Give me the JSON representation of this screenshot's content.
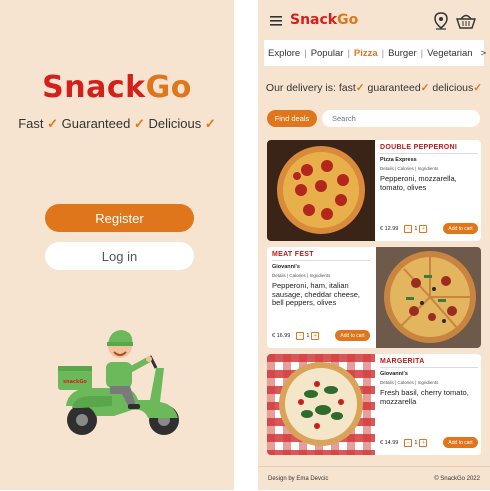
{
  "left": {
    "logo": {
      "part1": "Snack",
      "part2": "Go"
    },
    "tagline": {
      "w1": "Fast",
      "w2": "Guaranteed",
      "w3": "Delicious",
      "check": "✓"
    },
    "register_label": "Register",
    "login_label": "Log in"
  },
  "header": {
    "brand": {
      "part1": "Snack",
      "part2": "Go"
    },
    "icons": [
      "menu-icon",
      "location-pin-icon",
      "basket-icon"
    ]
  },
  "categories": [
    "Explore",
    "Popular",
    "Pizza",
    "Burger",
    "Vegetarian",
    ">"
  ],
  "active_category": "Pizza",
  "delivery": {
    "prefix": "Our delivery is:",
    "w1": "fast",
    "w2": "guaranteed",
    "w3": "delicious",
    "check": "✓"
  },
  "search": {
    "button_label": "Find deals",
    "placeholder": "Search"
  },
  "products": [
    {
      "title": "DOUBLE PEPPERONI",
      "shop": "Pizza Express",
      "links": "Details  |  Calories  |  Ingridients",
      "desc": "Pepperoni, mozzarella, tomato, olives",
      "price": "€ 12.99",
      "qty": "1",
      "add_label": "Add to cart"
    },
    {
      "title": "MEAT FEST",
      "shop": "Giovanni's",
      "links": "Details  |  Calories  |  Ingridients",
      "desc": "Pepperoni, ham, italian sausage, cheddar cheese, bell peppers, olives",
      "price": "€ 16.99",
      "qty": "1",
      "add_label": "Add to cart"
    },
    {
      "title": "MARGERITA",
      "shop": "Giovanni's",
      "links": "Details  |  Calories  |  Ingridients",
      "desc": "Fresh basil, cherry tomato, mozzarella",
      "price": "€ 14.99",
      "qty": "1",
      "add_label": "Add to cart"
    }
  ],
  "footer": {
    "credit": "Design by Ema Devcic",
    "copyright": "© SnackGo 2022"
  },
  "colors": {
    "accent": "#e0761b",
    "brand_red": "#d4201b",
    "background": "#f7e4d0"
  }
}
